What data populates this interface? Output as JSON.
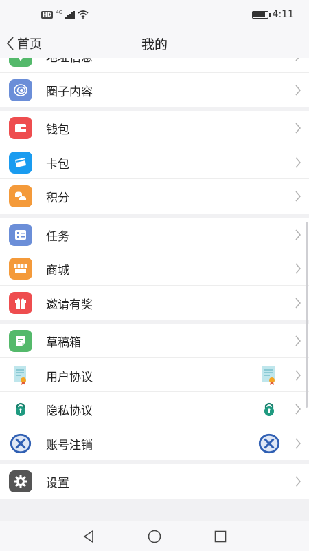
{
  "status_bar": {
    "hd": "HD",
    "network": "4G",
    "time": "4:11",
    "battery_level": 0.9
  },
  "nav": {
    "back_label": "首页",
    "title": "我的"
  },
  "groups": [
    {
      "items": [
        {
          "label": "地址信息",
          "icon": "location-icon",
          "color": "#54b96b"
        },
        {
          "label": "圈子内容",
          "icon": "circle-icon",
          "color": "#6b8ed8"
        }
      ]
    },
    {
      "items": [
        {
          "label": "钱包",
          "icon": "wallet-icon",
          "color": "#ee4d4f"
        },
        {
          "label": "卡包",
          "icon": "card-icon",
          "color": "#1a9cf0"
        },
        {
          "label": "积分",
          "icon": "points-icon",
          "color": "#f49a3a"
        }
      ]
    },
    {
      "items": [
        {
          "label": "任务",
          "icon": "task-icon",
          "color": "#6b8ed8"
        },
        {
          "label": "商城",
          "icon": "store-icon",
          "color": "#f49a3a"
        },
        {
          "label": "邀请有奖",
          "icon": "gift-icon",
          "color": "#ee4d4f"
        }
      ]
    },
    {
      "items": [
        {
          "label": "草稿箱",
          "icon": "draft-icon",
          "color": "#54b96b"
        },
        {
          "label": "用户协议",
          "icon": "agreement-icon"
        },
        {
          "label": "隐私协议",
          "icon": "privacy-lock-icon"
        },
        {
          "label": "账号注销",
          "icon": "cancel-account-icon"
        }
      ]
    },
    {
      "items": [
        {
          "label": "设置",
          "icon": "gear-icon",
          "color": "#555555"
        }
      ]
    }
  ]
}
